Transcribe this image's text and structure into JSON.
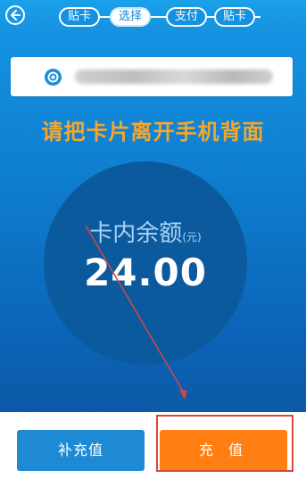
{
  "header": {
    "back_icon": "back-arrow-icon",
    "steps": [
      {
        "label": "贴卡",
        "active": false
      },
      {
        "label": "选择",
        "active": true
      },
      {
        "label": "支付",
        "active": false
      },
      {
        "label": "贴卡",
        "active": false
      }
    ]
  },
  "card": {
    "icon": "card-logo-icon",
    "number": "•••• •••• •••• ••••"
  },
  "instruction": "请把卡片离开手机背面",
  "balance": {
    "label": "卡内余额",
    "unit": "(元)",
    "amount": "24.00"
  },
  "actions": {
    "supplement_label": "补充值",
    "recharge_label": "充 值"
  },
  "colors": {
    "accent_orange": "#ff7f12",
    "instruction_orange": "#f7a62b",
    "primary_blue": "#1e8ad3",
    "annotation_red": "#d9473c"
  }
}
